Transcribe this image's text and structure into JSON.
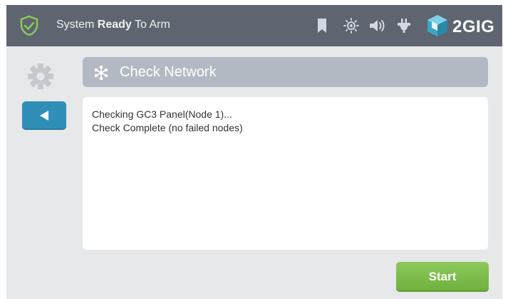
{
  "topbar": {
    "status_prefix": "System ",
    "status_bold": "Ready",
    "status_suffix": " To Arm",
    "brand": "2GIG",
    "icons": [
      "shield-check-icon",
      "bookmark-icon",
      "brightness-icon",
      "volume-icon",
      "power-plug-icon"
    ]
  },
  "sidebar": {
    "settings_icon": "gear-icon",
    "back_icon": "back-arrow-icon"
  },
  "header": {
    "icon": "snowflake-network-icon",
    "title": "Check Network"
  },
  "log": {
    "lines": [
      "Checking GC3 Panel(Node 1)...",
      "Check Complete (no failed nodes)"
    ]
  },
  "actions": {
    "start_label": "Start"
  },
  "colors": {
    "topbar": "#5e6470",
    "accent_green": "#8cc95a",
    "back_blue": "#2f8fb7",
    "header_gray": "#b3b9c2",
    "background": "#e7e8ea"
  }
}
